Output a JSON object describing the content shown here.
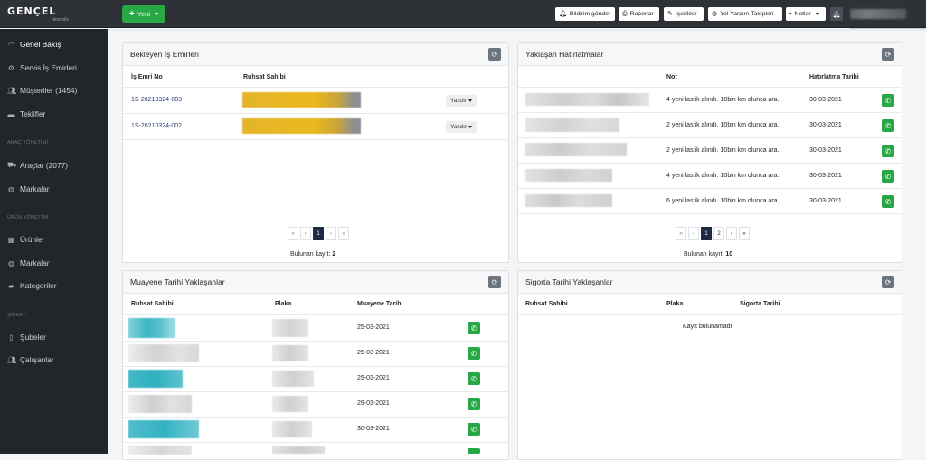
{
  "brand": {
    "name": "GENÇEL",
    "sub": "otomotiv"
  },
  "topbar": {
    "new_label": "Yeni",
    "buttons": [
      {
        "label": "Bildirim gönder",
        "icon": "bell-icon"
      },
      {
        "label": "Raporlar",
        "icon": "printer-icon"
      },
      {
        "label": "İçerikler",
        "icon": "pencil-icon"
      },
      {
        "label": "Yol Yardım Talepleri",
        "icon": "globe-icon"
      },
      {
        "label": "Notlar",
        "icon": "note-icon"
      }
    ]
  },
  "sidebar": {
    "items": [
      {
        "label": "Genel Bakış",
        "icon": "dashboard-icon"
      },
      {
        "label": "Servis İş Emirleri",
        "icon": "wrench-icon"
      },
      {
        "label": "Müşteriler (1454)",
        "icon": "users-icon"
      },
      {
        "label": "Teklifler",
        "icon": "file-icon"
      },
      {
        "label": "Araçlar (2077)",
        "icon": "car-icon"
      },
      {
        "label": "Markalar",
        "icon": "globe-icon"
      },
      {
        "label": "Ürünler",
        "icon": "box-icon"
      },
      {
        "label": "Markalar",
        "icon": "globe-icon"
      },
      {
        "label": "Kategoriler",
        "icon": "folder-icon"
      },
      {
        "label": "Şubeler",
        "icon": "building-icon"
      },
      {
        "label": "Çalışanlar",
        "icon": "users-icon"
      }
    ],
    "headings": [
      "ARAÇ YÖNETİMİ",
      "ÜRÜN YÖNETİMİ",
      "ŞİRKET"
    ]
  },
  "work_orders": {
    "title": "Bekleyen İş Emirleri",
    "col_no": "İş Emri No",
    "col_owner": "Ruhsat Sahibi",
    "rows": [
      {
        "no": "1S-20210324-003",
        "action": "Yazdır"
      },
      {
        "no": "1S-20210324-002",
        "action": "Yazdır"
      }
    ],
    "pager": {
      "current": "1"
    },
    "found_label": "Bulunan kayıt:",
    "found_count": "2"
  },
  "reminders": {
    "title": "Yaklaşan Hatırlatmalar",
    "col_note": "Not",
    "col_date": "Hatırlatma Tarihi",
    "rows": [
      {
        "note": "4 yeni lastik alındı. 10bin km olunca ara.",
        "date": "30-03-2021"
      },
      {
        "note": "2 yeni lastik alındı. 10bin km olunca ara.",
        "date": "30-03-2021"
      },
      {
        "note": "2 yeni lastik alındı. 10bin km olunca ara.",
        "date": "30-03-2021"
      },
      {
        "note": "4 yeni lastik alındı. 10bin km olunca ara.",
        "date": "30-03-2021"
      },
      {
        "note": "6 yeni lastik alındı. 10bin km olunca ara.",
        "date": "30-03-2021"
      }
    ],
    "pager": {
      "p1": "1",
      "p2": "2"
    },
    "found_label": "Bulunan kayıt:",
    "found_count": "10"
  },
  "inspection": {
    "title": "Muayene Tarihi Yaklaşanlar",
    "col_owner": "Ruhsat Sahibi",
    "col_plate": "Plaka",
    "col_date": "Muayene Tarihi",
    "rows": [
      {
        "date": "25-03-2021"
      },
      {
        "date": "25-03-2021"
      },
      {
        "date": "29-03-2021"
      },
      {
        "date": "29-03-2021"
      },
      {
        "date": "30-03-2021"
      }
    ]
  },
  "insurance": {
    "title": "Sigorta Tarihi Yaklaşanlar",
    "col_owner": "Ruhsat Sahibi",
    "col_plate": "Plaka",
    "col_date": "Sigorta Tarihi",
    "empty": "Kayıt bulunamadı"
  },
  "colors": {
    "topbar": "#2e3236",
    "sidebar": "#222629",
    "accent_green": "#28a745",
    "pager_active": "#1f2a44"
  }
}
